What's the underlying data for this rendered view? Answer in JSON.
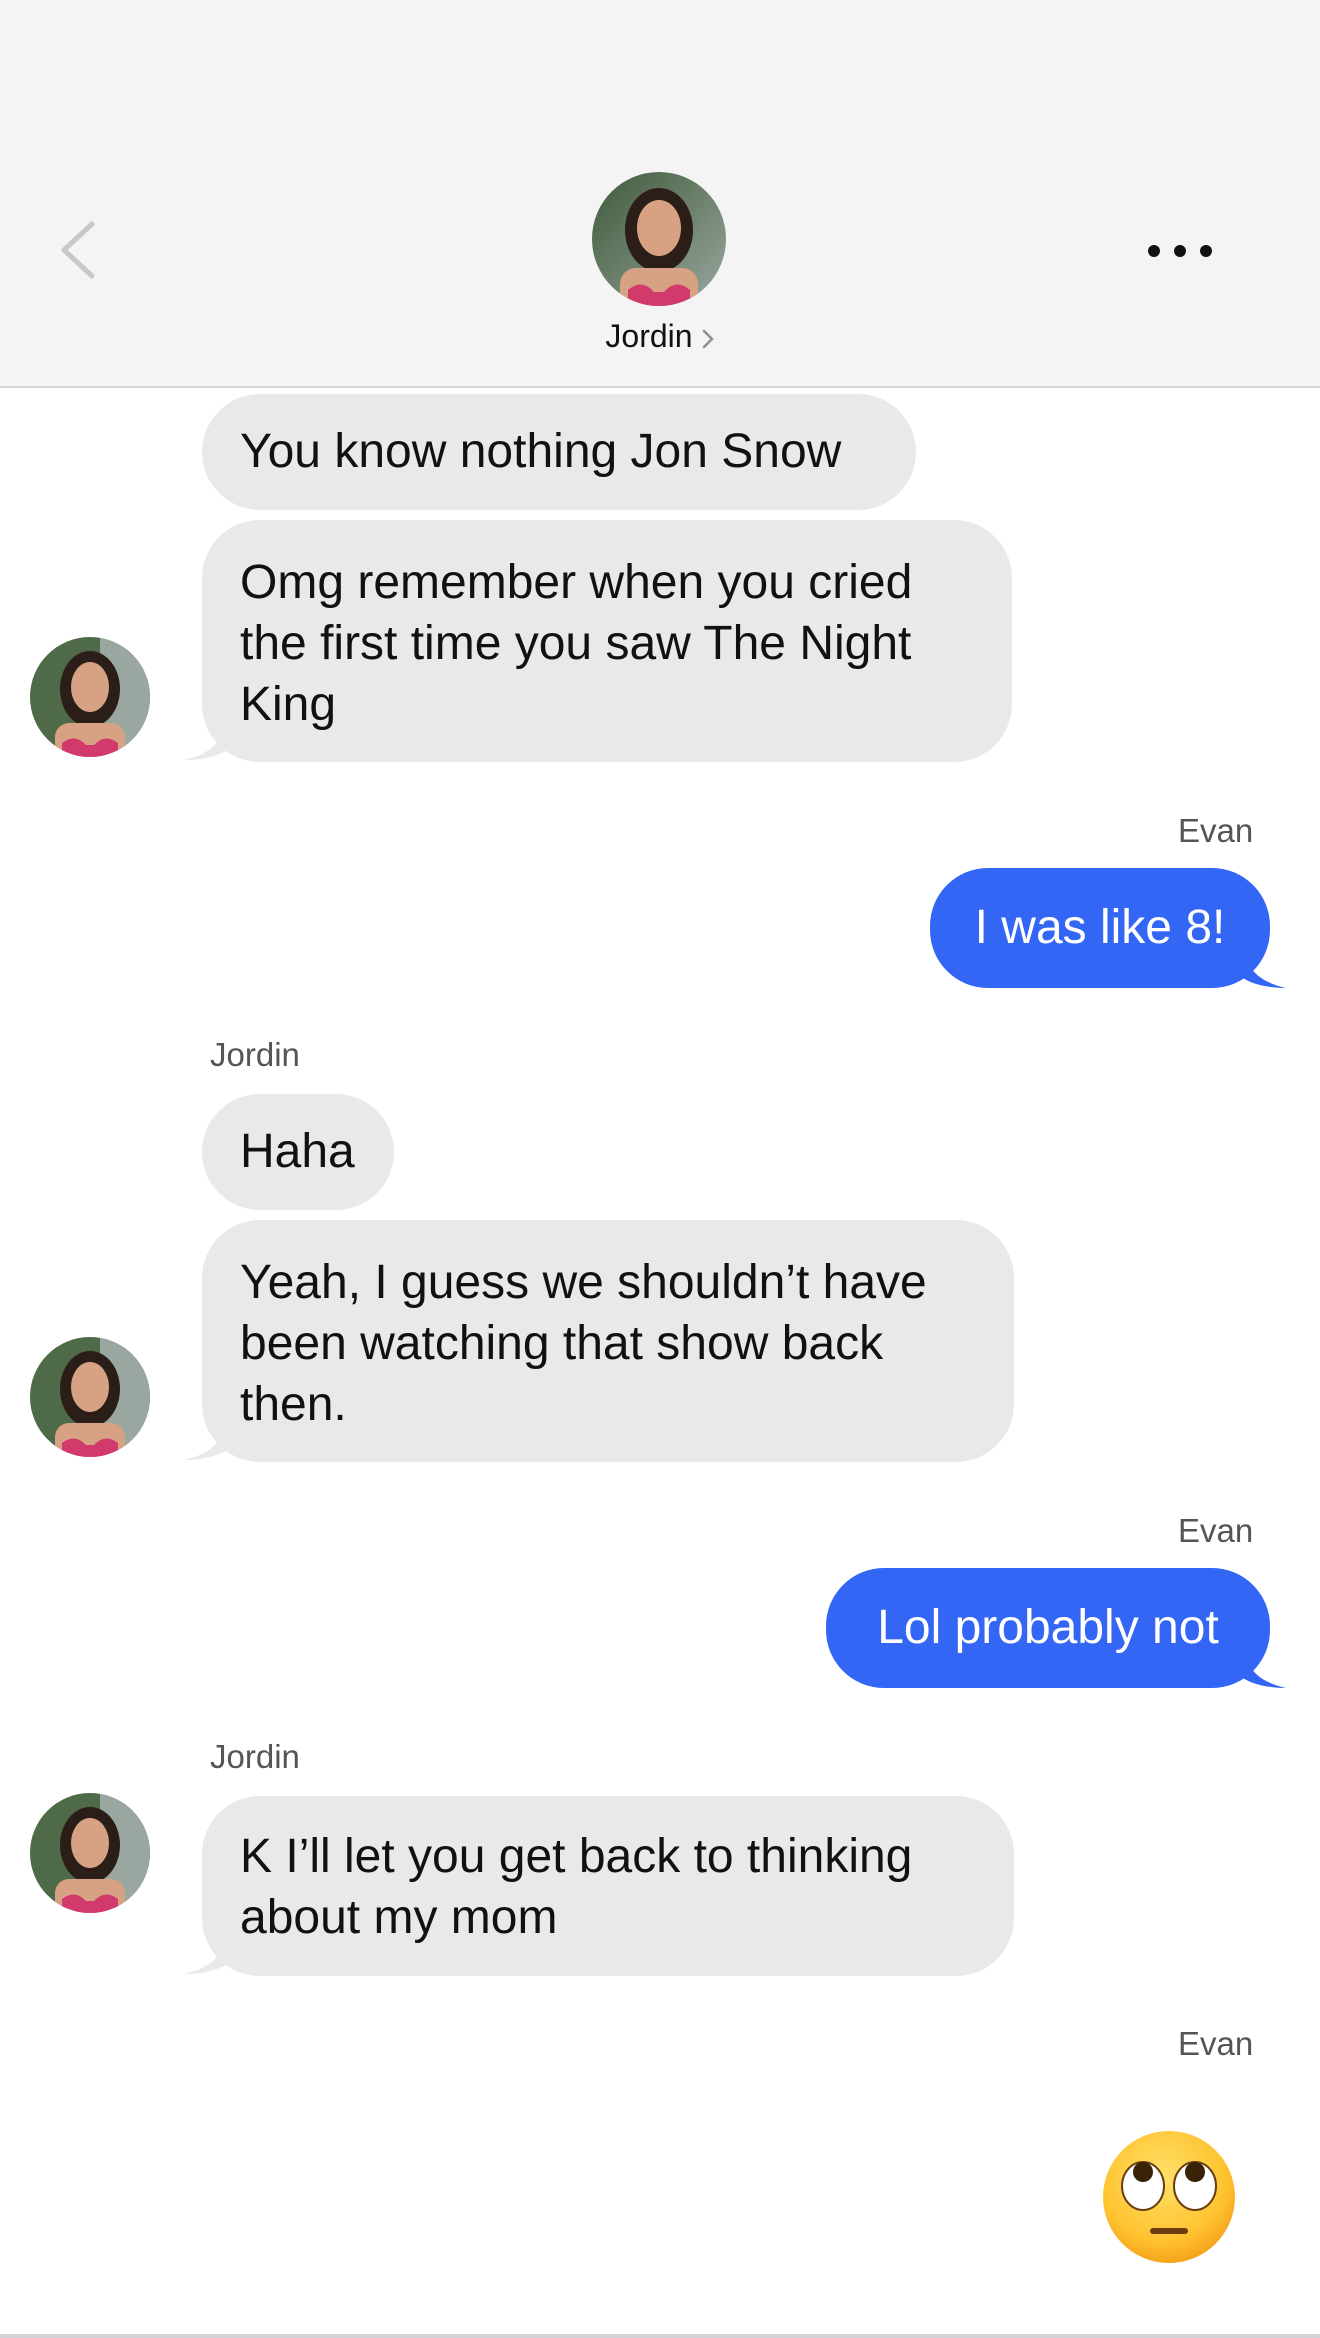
{
  "header": {
    "contact_name": "Jordin",
    "back_icon": "chevron-left-icon",
    "more_icon": "ellipsis-icon"
  },
  "colors": {
    "incoming_bubble": "#e9e9eb",
    "outgoing_bubble": "#3466f6",
    "header_bg": "#f4f4f5"
  },
  "messages": [
    {
      "sender": "Jordin",
      "direction": "incoming",
      "text": "You know nothing Jon Snow"
    },
    {
      "sender": "Jordin",
      "direction": "incoming",
      "lines": [
        "Omg remember when you cried",
        "the first time you saw The Night",
        "King"
      ]
    },
    {
      "sender": "Evan",
      "sender_label": "Evan",
      "direction": "outgoing",
      "text": "I was like 8!"
    },
    {
      "sender": "Jordin",
      "sender_label": "Jordin",
      "direction": "incoming",
      "text": "Haha"
    },
    {
      "sender": "Jordin",
      "direction": "incoming",
      "lines": [
        "Yeah, I guess we shouldn’t have",
        "been watching that show back",
        "then."
      ]
    },
    {
      "sender": "Evan",
      "sender_label": "Evan",
      "direction": "outgoing",
      "text": "Lol probably not"
    },
    {
      "sender": "Jordin",
      "sender_label": "Jordin",
      "direction": "incoming",
      "lines": [
        "K I’ll let you get back to thinking",
        "about my mom"
      ]
    },
    {
      "sender": "Evan",
      "sender_label": "Evan",
      "direction": "outgoing",
      "emoji": "face-with-rolling-eyes-icon"
    }
  ]
}
